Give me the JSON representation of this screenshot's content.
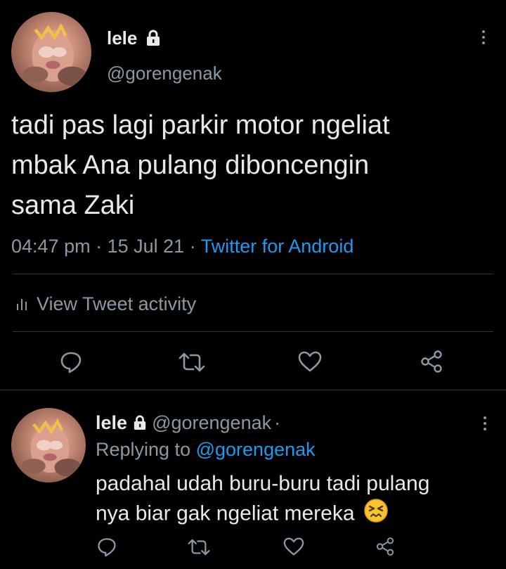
{
  "main_tweet": {
    "display_name": "lele",
    "handle": "@gorengenak",
    "text_lines": [
      "tadi pas lagi parkir motor ngeliat",
      "mbak Ana pulang diboncengin",
      "sama Zaki"
    ],
    "time": "04:47 pm",
    "sep1": "·",
    "date": "15 Jul 21",
    "sep2": "·",
    "source": "Twitter for Android",
    "activity_label": "View Tweet activity",
    "actions": [
      "reply-icon",
      "retweet-icon",
      "like-icon",
      "share-icon"
    ]
  },
  "reply_tweet": {
    "display_name": "lele",
    "handle": "@gorengenak",
    "dot": "·",
    "replying_prefix": "Replying to",
    "replying_handle": "@gorengenak",
    "text_lines": [
      "padahal udah buru-buru tadi pulang",
      "nya biar gak ngeliat mereka"
    ],
    "emoji": "😣",
    "actions": [
      "reply-icon",
      "retweet-icon",
      "like-icon",
      "share-icon"
    ]
  },
  "colors": {
    "background": "#000000",
    "text": "#e7e9ea",
    "muted": "#8b98a5",
    "link": "#1d9bf0",
    "divider": "#2f3336"
  }
}
